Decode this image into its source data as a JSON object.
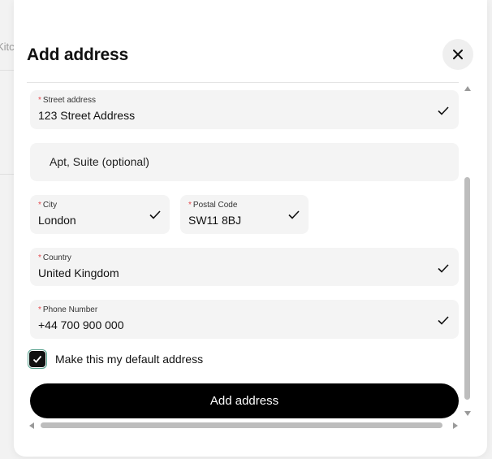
{
  "background": {
    "fragment_text": "Kitc"
  },
  "modal": {
    "title": "Add address",
    "close_icon": "close-icon",
    "fields": {
      "street": {
        "label": "Street address",
        "required_marker": "*",
        "value": "123 Street Address"
      },
      "apt": {
        "placeholder": "Apt, Suite (optional)"
      },
      "city": {
        "label": "City",
        "required_marker": "*",
        "value": "London"
      },
      "postal": {
        "label": "Postal Code",
        "required_marker": "*",
        "value": "SW11 8BJ"
      },
      "country": {
        "label": "Country",
        "required_marker": "*",
        "value": "United Kingdom"
      },
      "phone": {
        "label": "Phone Number",
        "required_marker": "*",
        "value": "+44 700 900 000"
      }
    },
    "default_checkbox": {
      "label": "Make this my default address",
      "checked": true
    },
    "submit_label": "Add address"
  },
  "colors": {
    "required": "#e5484d",
    "button_bg": "#000000",
    "field_bg": "#f4f4f4",
    "checkbox_focus": "#58a28f"
  }
}
